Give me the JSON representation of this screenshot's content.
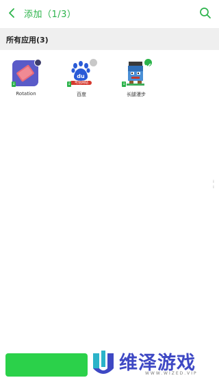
{
  "header": {
    "title": "添加（1/3）",
    "back_icon": "chevron-left-icon",
    "search_icon": "search-icon"
  },
  "section": {
    "title": "所有应用(3)"
  },
  "apps": [
    {
      "label": "Rotation",
      "selected": false,
      "status_color": "#3d3d6b"
    },
    {
      "label": "百度",
      "selected": false,
      "status_color": "#c8c8c8",
      "banner_text": "可信网站"
    },
    {
      "label": "长腿漫步",
      "selected": true,
      "status_color": "#2bb34a"
    }
  ],
  "watermark": {
    "brand": "维泽游戏",
    "subtitle": "WWW.WIZED.VIP"
  },
  "colors": {
    "accent": "#2bb34a",
    "button": "#2bd14a",
    "brand": "#3e48c4"
  }
}
